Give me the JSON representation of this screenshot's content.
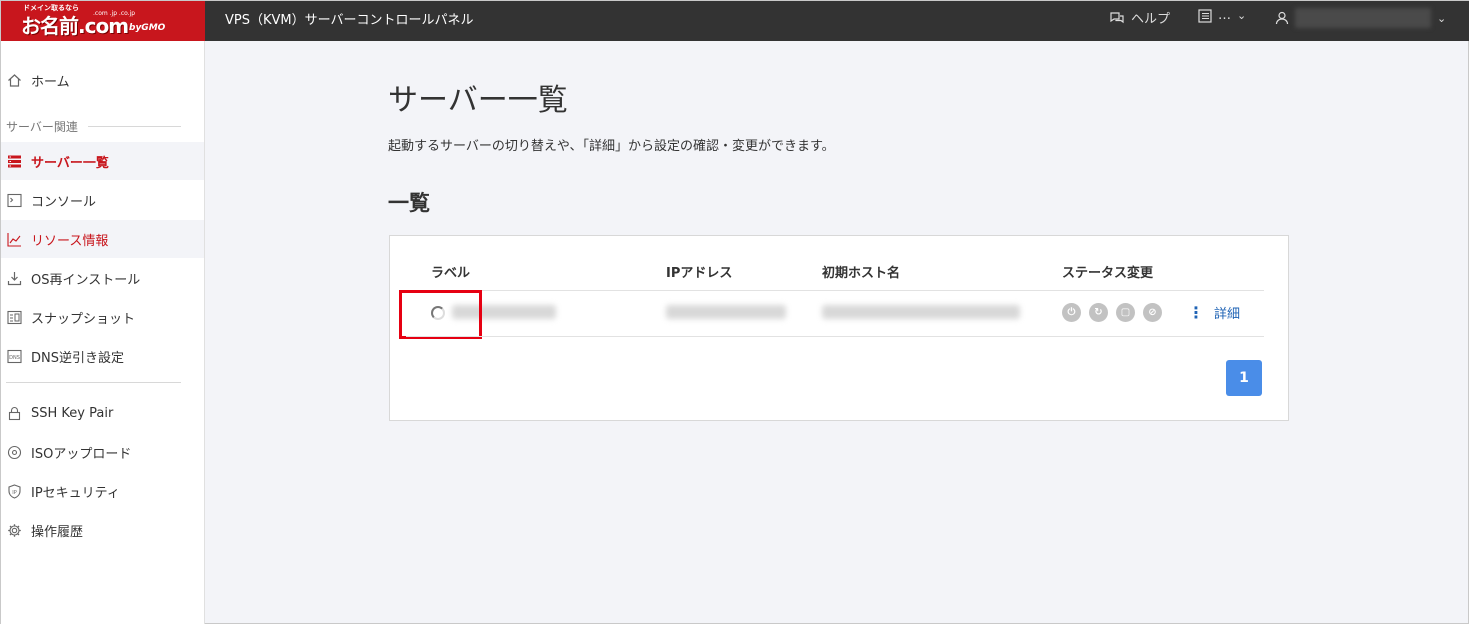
{
  "header": {
    "logo": {
      "tagline": "ドメイン取るなら",
      "brand": "お名前.com",
      "tlds": ".com .jp .co.jp",
      "company": "byGMO"
    },
    "app_title": "VPS（KVM）サーバーコントロールパネル",
    "help_label": "ヘルプ",
    "menu_label": "…",
    "user_name": "[redacted]"
  },
  "sidebar": {
    "home": "ホーム",
    "section_server": "サーバー関連",
    "items": [
      {
        "label": "サーバー一覧",
        "icon": "server-list-icon"
      },
      {
        "label": "コンソール",
        "icon": "console-icon"
      },
      {
        "label": "リソース情報",
        "icon": "chart-icon"
      },
      {
        "label": "OS再インストール",
        "icon": "download-icon"
      },
      {
        "label": "スナップショット",
        "icon": "snapshot-icon"
      },
      {
        "label": "DNS逆引き設定",
        "icon": "dns-icon"
      }
    ],
    "items2": [
      {
        "label": "SSH Key Pair",
        "icon": "lock-icon"
      },
      {
        "label": "ISOアップロード",
        "icon": "disc-icon"
      },
      {
        "label": "IPセキュリティ",
        "icon": "shield-icon"
      },
      {
        "label": "操作履歴",
        "icon": "gear-icon"
      }
    ]
  },
  "main": {
    "title": "サーバー一覧",
    "description": "起動するサーバーの切り替えや、「詳細」から設定の確認・変更ができます。",
    "section_title": "一覧",
    "table": {
      "headers": [
        "ラベル",
        "IPアドレス",
        "初期ホスト名",
        "ステータス変更"
      ],
      "rows": [
        {
          "label": "[redacted]",
          "ip": "[redacted]",
          "hostname": "[redacted]",
          "detail": "詳細"
        }
      ]
    },
    "pagination": {
      "current": "1"
    }
  }
}
